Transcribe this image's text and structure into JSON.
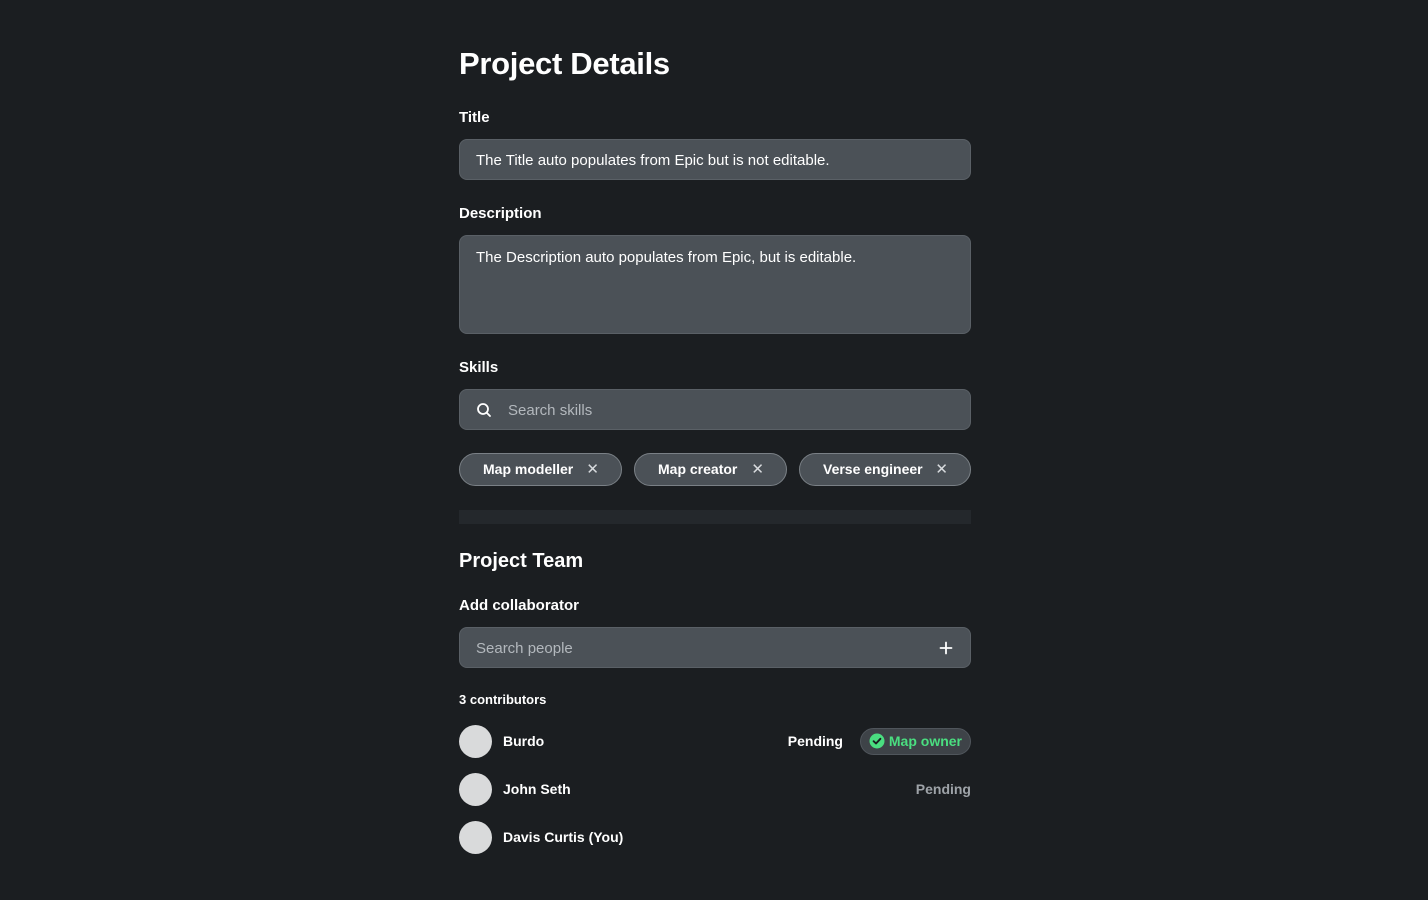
{
  "project_details": {
    "heading": "Project Details",
    "title_label": "Title",
    "title_value": "The Title auto populates from Epic but is not editable.",
    "description_label": "Description",
    "description_value": "The Description auto populates from Epic, but is editable.",
    "skills_label": "Skills",
    "skills_placeholder": "Search skills",
    "skills": [
      {
        "label": "Map modeller",
        "remove": "✕"
      },
      {
        "label": "Map creator",
        "remove": "✕"
      },
      {
        "label": "Verse engineer",
        "remove": "✕"
      }
    ]
  },
  "project_team": {
    "heading": "Project Team",
    "add_label": "Add collaborator",
    "people_placeholder": "Search people",
    "contributors_count": "3 contributors",
    "contributors": [
      {
        "name": "Burdo",
        "status": "Pending",
        "badge": "Map owner"
      },
      {
        "name": "John Seth",
        "status": "Pending"
      },
      {
        "name": "Davis Curtis (You)"
      }
    ]
  },
  "colors": {
    "background": "#1b1e21",
    "field": "#4b5157",
    "badge_text": "#4ade80"
  },
  "icons": [
    "search-icon",
    "close-icon",
    "plus-icon",
    "check-circle-icon"
  ]
}
